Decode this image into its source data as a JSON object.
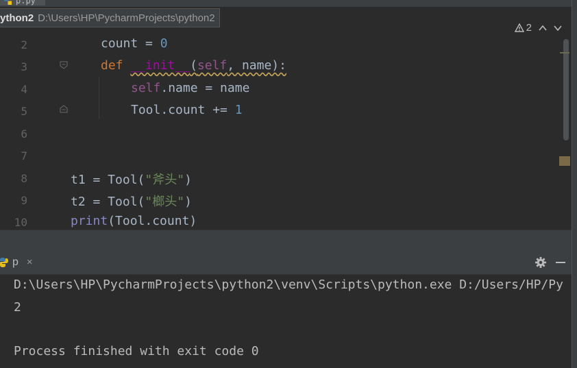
{
  "editor_tab": {
    "label": "p.py"
  },
  "breadcrumb": {
    "project": "ython2",
    "path": "D:\\Users\\HP\\PycharmProjects\\python2"
  },
  "inspection": {
    "warning_count": "2"
  },
  "gutter": [
    "2",
    "3",
    "4",
    "5",
    "6",
    "7",
    "8",
    "9",
    "10"
  ],
  "code": {
    "l2": {
      "ident": "count",
      "op": " = ",
      "num": "0"
    },
    "l3": {
      "kw": "def",
      "name": "__init__",
      "open": "(",
      "self": "self",
      "rest": ", name):"
    },
    "l4": {
      "self": "self",
      "rest": ".name = name"
    },
    "l5": {
      "pre": "Tool.count += ",
      "num": "1"
    },
    "l8": {
      "pre": "t1 = Tool(",
      "str": "\"斧头\"",
      "post": ")"
    },
    "l9": {
      "pre": "t2 = Tool(",
      "str": "\"榔头\"",
      "post": ")"
    },
    "l10": {
      "builtin": "print",
      "rest": "(Tool.count)"
    }
  },
  "run": {
    "tab_label": "p",
    "tab_close": "×",
    "settings_icon": "gear-icon",
    "minimize_icon": "minimize-icon",
    "output": [
      "D:\\Users\\HP\\PycharmProjects\\python2\\venv\\Scripts\\python.exe D:/Users/HP/Py",
      "2",
      "",
      "Process finished with exit code 0"
    ]
  },
  "colors": {
    "editor_bg": "#2b2b2b",
    "panel_bg": "#3c3f41",
    "keyword": "#cc7832",
    "string": "#6a8759",
    "number": "#6897bb",
    "self": "#94558d"
  }
}
